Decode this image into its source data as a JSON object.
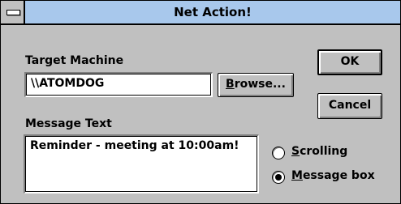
{
  "window": {
    "title": "Net Action!"
  },
  "target": {
    "label": "Target Machine",
    "value": "\\\\ATOMDOG",
    "browse_first": "B",
    "browse_rest": "rowse..."
  },
  "buttons": {
    "ok": "OK",
    "cancel": "Cancel"
  },
  "message": {
    "label": "Message Text",
    "value": "Reminder - meeting at 10:00am!"
  },
  "options": {
    "scrolling_first": "S",
    "scrolling_rest": "crolling",
    "scrolling_selected": false,
    "msgbox_first": "M",
    "msgbox_rest": "essage box",
    "msgbox_selected": true
  }
}
